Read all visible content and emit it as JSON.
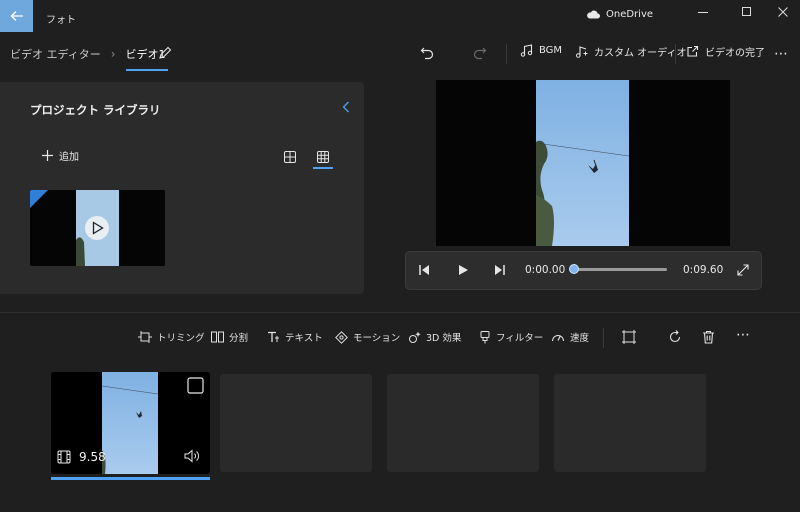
{
  "titlebar": {
    "app_title": "フォト",
    "onedrive_label": "OneDrive"
  },
  "breadcrumb": {
    "root": "ビデオ エディター",
    "current": "ビデオ1"
  },
  "topbar": {
    "bgm_label": "BGM",
    "custom_audio_label": "カスタム オーディオ",
    "finish_label": "ビデオの完了"
  },
  "library": {
    "title": "プロジェクト ライブラリ",
    "add_label": "追加"
  },
  "player": {
    "current_time": "0:00.00",
    "total_time": "0:09.60",
    "progress": 0.0
  },
  "storyboard_tools": {
    "trim": "トリミング",
    "split": "分割",
    "text": "テキスト",
    "motion": "モーション",
    "effects3d": "3D 効果",
    "filter": "フィルター",
    "speed": "速度"
  },
  "clips": [
    {
      "duration": "9.58"
    }
  ],
  "colors": {
    "accent": "#4ea1f3",
    "back_button": "#6fa8dc",
    "background": "#1f1f1f",
    "panel": "#2b2b2b"
  }
}
